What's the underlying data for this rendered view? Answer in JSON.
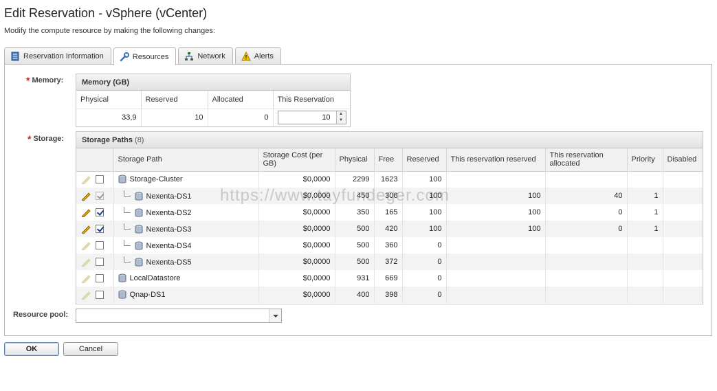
{
  "page": {
    "title": "Edit Reservation - vSphere (vCenter)",
    "subtitle": "Modify the compute resource by making the following changes:"
  },
  "tabs": [
    {
      "label": "Reservation Information",
      "icon": "document-icon",
      "active": false
    },
    {
      "label": "Resources",
      "icon": "wrench-icon",
      "active": true
    },
    {
      "label": "Network",
      "icon": "network-icon",
      "active": false
    },
    {
      "label": "Alerts",
      "icon": "warning-icon",
      "active": false
    }
  ],
  "memory": {
    "label": "Memory:",
    "box_title": "Memory (GB)",
    "columns": [
      "Physical",
      "Reserved",
      "Allocated",
      "This Reservation"
    ],
    "physical": "33,9",
    "reserved": "10",
    "allocated": "0",
    "this_reservation": "10"
  },
  "storage": {
    "label": "Storage:",
    "box_title": "Storage Paths",
    "count": "(8)",
    "columns": [
      "Storage Path",
      "Storage Cost (per GB)",
      "Physical",
      "Free",
      "Reserved",
      "This reservation reserved",
      "This reservation allocated",
      "Priority",
      "Disabled"
    ],
    "rows": [
      {
        "name": "Storage-Cluster",
        "indent": false,
        "checked": false,
        "editable": false,
        "cost": "$0,0000",
        "physical": "2299",
        "free": "1623",
        "reserved": "100",
        "this_reserved": "",
        "this_allocated": "",
        "priority": "",
        "disabled": ""
      },
      {
        "name": "Nexenta-DS1",
        "indent": true,
        "checked": true,
        "editable": true,
        "cost": "$0,0000",
        "physical": "450",
        "free": "306",
        "reserved": "100",
        "this_reserved": "100",
        "this_allocated": "40",
        "priority": "1",
        "disabled": ""
      },
      {
        "name": "Nexenta-DS2",
        "indent": true,
        "checked": true,
        "editable": true,
        "cost": "$0,0000",
        "physical": "350",
        "free": "165",
        "reserved": "100",
        "this_reserved": "100",
        "this_allocated": "0",
        "priority": "1",
        "disabled": ""
      },
      {
        "name": "Nexenta-DS3",
        "indent": true,
        "checked": true,
        "editable": true,
        "cost": "$0,0000",
        "physical": "500",
        "free": "420",
        "reserved": "100",
        "this_reserved": "100",
        "this_allocated": "0",
        "priority": "1",
        "disabled": ""
      },
      {
        "name": "Nexenta-DS4",
        "indent": true,
        "checked": false,
        "editable": false,
        "cost": "$0,0000",
        "physical": "500",
        "free": "360",
        "reserved": "0",
        "this_reserved": "",
        "this_allocated": "",
        "priority": "",
        "disabled": ""
      },
      {
        "name": "Nexenta-DS5",
        "indent": true,
        "checked": false,
        "editable": false,
        "cost": "$0,0000",
        "physical": "500",
        "free": "372",
        "reserved": "0",
        "this_reserved": "",
        "this_allocated": "",
        "priority": "",
        "disabled": ""
      },
      {
        "name": "LocalDatastore",
        "indent": false,
        "checked": false,
        "editable": false,
        "cost": "$0,0000",
        "physical": "931",
        "free": "669",
        "reserved": "0",
        "this_reserved": "",
        "this_allocated": "",
        "priority": "",
        "disabled": ""
      },
      {
        "name": "Qnap-DS1",
        "indent": false,
        "checked": false,
        "editable": false,
        "cost": "$0,0000",
        "physical": "400",
        "free": "398",
        "reserved": "0",
        "this_reserved": "",
        "this_allocated": "",
        "priority": "",
        "disabled": ""
      }
    ]
  },
  "resource_pool": {
    "label": "Resource pool:",
    "value": ""
  },
  "buttons": {
    "ok": "OK",
    "cancel": "Cancel"
  },
  "watermark": "https://www.tayfundeger.com",
  "colors": {
    "required_asterisk": "#cc2222",
    "pencil_active": "#e0a800",
    "pencil_inactive": "#e8dcb0",
    "checkbox_check": "#1a3f8a"
  }
}
